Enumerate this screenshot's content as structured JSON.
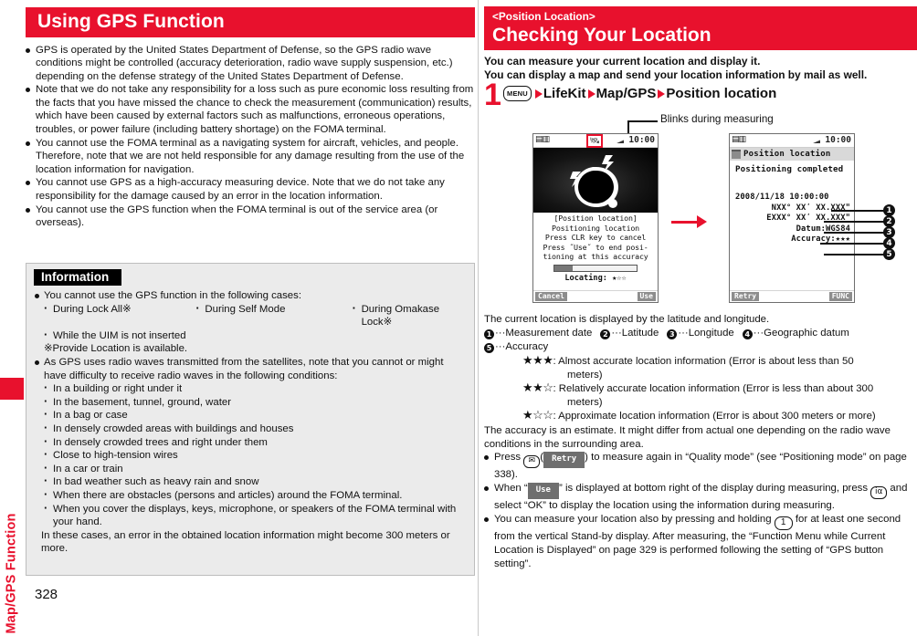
{
  "page_number": "328",
  "side_tab": {
    "label": "Map/GPS Function"
  },
  "left": {
    "banner_title": "Using GPS Function",
    "bullets": [
      "GPS is operated by the United States Department of Defense, so the GPS radio wave conditions might be controlled (accuracy deterioration, radio wave supply suspension, etc.) depending on the defense strategy of the United States Department of Defense.",
      "Note that we do not take any responsibility for a loss such as pure economic loss resulting from the facts that you have missed the chance to check the measurement (communication) results, which have been caused by external factors such as malfunctions, erroneous operations, troubles, or power failure (including battery shortage) on the FOMA terminal.",
      "You cannot use the FOMA terminal as a navigating system for aircraft, vehicles, and people. Therefore, note that we are not held responsible for any damage resulting from the use of the location information for navigation.",
      "You cannot use GPS as a high-accuracy measuring device. Note that we do not take any responsibility for the damage caused by an error in the location information.",
      "You cannot use the GPS function when the FOMA terminal is out of the service area (or overseas)."
    ],
    "info": {
      "title": "Information",
      "bullet1": "You cannot use the GPS function in the following cases:",
      "cases": [
        "During Lock All※",
        "During Self Mode",
        "During Omakase Lock※"
      ],
      "case_extra": "While the UIM is not inserted",
      "note": "※Provide Location is available.",
      "bullet2": "As GPS uses radio waves transmitted from the satellites, note that you cannot or might have difficulty to receive radio waves in the following conditions:",
      "conditions": [
        "In a building or right under it",
        "In the basement, tunnel, ground, water",
        "In a bag or case",
        "In densely crowded areas with buildings and houses",
        "In densely crowded trees and right under them",
        "Close to high-tension wires",
        "In a car or train",
        "In bad weather such as heavy rain and snow",
        "When there are obstacles (persons and articles) around the FOMA terminal.",
        "When you cover the displays, keys, microphone, or speakers of the FOMA terminal with your hand."
      ],
      "closing": "In these cases, an error in the obtained location information might become 300 meters or more."
    }
  },
  "right": {
    "banner_sub": "<Position Location>",
    "banner_title": "Checking Your Location",
    "lead_line1": "You can measure your current location and display it.",
    "lead_line2": "You can display a map and send your location information by mail as well.",
    "step": {
      "number": "1",
      "menu_key": "MENU",
      "items": [
        "LifeKit",
        "Map/GPS",
        "Position location"
      ]
    },
    "figure": {
      "blinks_label": "Blinks during measuring",
      "phone_a": {
        "clock": "10:00",
        "msg_lines": [
          "[Position location]",
          " Positioning location",
          "Press CLR key to cancel",
          "Press ˝Use˝ to end posi-",
          "tioning at this accuracy"
        ],
        "locating": "Locating: ★☆☆",
        "softkey_left": "Cancel",
        "softkey_right": "Use"
      },
      "phone_b": {
        "clock": "10:00",
        "title": "Position location",
        "status": "Positioning completed",
        "rows": [
          "2008/11/18 10:00:00",
          "NXX° XXʹ XX.XXXʺ",
          "EXXX° XXʹ XX.XXXʺ",
          "Datum:WGS84",
          "Accuracy:★★★"
        ],
        "callouts": [
          "1",
          "2",
          "3",
          "4",
          "5"
        ],
        "softkey_left": "Retry",
        "softkey_right": "FUNC"
      }
    },
    "body": {
      "intro": "The current location is displayed by the latitude and longitude.",
      "legend": [
        {
          "num": "1",
          "label": "Measurement date"
        },
        {
          "num": "2",
          "label": "Latitude"
        },
        {
          "num": "3",
          "label": "Longitude"
        },
        {
          "num": "4",
          "label": "Geographic datum"
        },
        {
          "num": "5",
          "label": "Accuracy"
        }
      ],
      "accuracy_levels": [
        {
          "stars": "★★★",
          "text": ": Almost accurate location information (Error is about less than 50",
          "cont": "meters)"
        },
        {
          "stars": "★★☆",
          "text": ": Relatively accurate location information (Error is less than about 300",
          "cont": "meters)"
        },
        {
          "stars": "★☆☆",
          "text": ": Approximate location information (Error is about 300 meters or more)",
          "cont": ""
        }
      ],
      "estimate_note": "The accuracy is an estimate. It might differ from actual one depending on the radio wave conditions in the surrounding area.",
      "bullets": [
        {
          "pre": "Press ",
          "keycap": "✉",
          "mid": "(",
          "pill": "Retry",
          "post": ") to measure again in “Quality mode” (see “Positioning mode” on page 338)."
        },
        {
          "pre": "When “",
          "pill": "Use",
          "post": "” is displayed at bottom right of the display during measuring, press ",
          "keycap": "iα",
          "post2": " and select “OK” to display the location using the information during measuring."
        },
        {
          "pre": "You can measure your location also by pressing and holding ",
          "keycap": "1",
          "post": " for at least one second from the vertical Stand-by display. After measuring, the “Function Menu while Current Location is Displayed” on page 329 is performed following the setting of “GPS button setting”."
        }
      ]
    }
  },
  "colors": {
    "brand_red": "#e8112d",
    "info_bg": "#ebebeb",
    "black": "#000000"
  }
}
